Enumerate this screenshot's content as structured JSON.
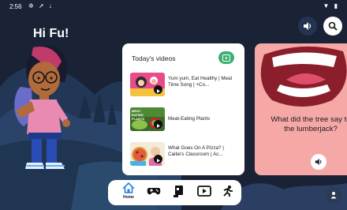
{
  "status_bar": {
    "time": "2:56"
  },
  "greeting": "Hi Fu!",
  "videos": {
    "title": "Today's videos",
    "items": [
      {
        "title": "Yum yum, Eat Healthy | Meal Time Song | +Co..."
      },
      {
        "title": "Meat-Eating Plants",
        "thumb_text": "MEAT-EATING PLANTS"
      },
      {
        "title": "What Goes On A Pizza? | Caitie's Classroom | Ac..."
      }
    ]
  },
  "promo": {
    "question": "What did the tree say to the lumberjack?"
  },
  "nav": {
    "home_label": "Home"
  },
  "colors": {
    "background": "#1a2235",
    "card": "#ffffff",
    "promo": "#f6a8a6",
    "accent_green": "#3bb072",
    "home_blue": "#2a7de1"
  }
}
